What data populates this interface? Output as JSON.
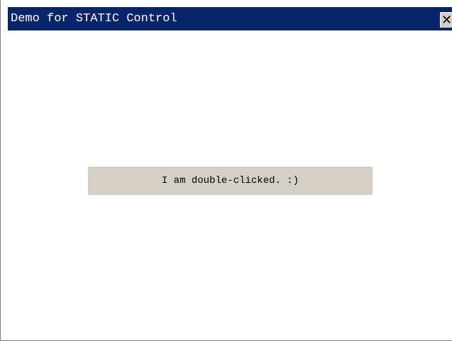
{
  "window": {
    "title": "Demo for STATIC Control",
    "close_glyph": "✕",
    "titlebar_color": "#0a246a"
  },
  "static_control": {
    "text": "I am double-clicked. :)",
    "background": "#d4d0c8"
  }
}
